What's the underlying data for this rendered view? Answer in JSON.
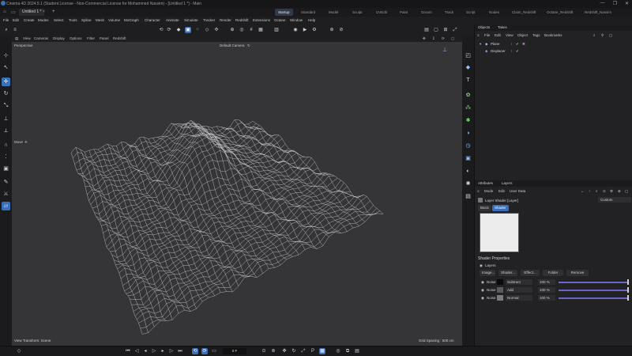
{
  "window": {
    "title": "Cinema 4D 2024.5.1 (Student License - Non-Commercial License for Mohammed Nassim) - [Untitled 1 *] - Main",
    "controls": [
      "—",
      "❐",
      "✕"
    ]
  },
  "document_tab": {
    "label": "Untitled 1 *",
    "close": "×",
    "add": "+"
  },
  "workspaces": [
    "Startup",
    "Standard",
    "Model",
    "Sculpt",
    "UVEdit",
    "Paint",
    "Groom",
    "Track",
    "Script",
    "Nodes",
    "Claim_Redshift",
    "Octane_Redshift",
    "Redshift_Nassim"
  ],
  "workspace_active": "Startup",
  "menus": [
    "File",
    "Edit",
    "Create",
    "Modes",
    "Select",
    "Tools",
    "Spline",
    "Mesh",
    "Volume",
    "MoGraph",
    "Character",
    "Animate",
    "Simulate",
    "Tracker",
    "Render",
    "Redshift",
    "Extensions",
    "Octane",
    "Window",
    "Help"
  ],
  "viewport": {
    "menu": [
      "View",
      "Cameras",
      "Display",
      "Options",
      "Filter",
      "Panel",
      "Redshift"
    ],
    "name": "Perspective",
    "camera": "Default Camera",
    "camera_glyph": "↻",
    "tool_label": "Move",
    "tool_glyph": "✛",
    "status_left": "View Transform: Scene",
    "status_right": "Grid Spacing : 500 cm"
  },
  "objects_panel": {
    "tabs": [
      "Objects",
      "Takes"
    ],
    "menu": [
      "File",
      "Edit",
      "View",
      "Object",
      "Tags",
      "Bookmarks"
    ],
    "objects": [
      {
        "name": "Plane",
        "check": "✔"
      },
      {
        "name": "Displacer",
        "check": "✔"
      }
    ]
  },
  "attributes_panel": {
    "tabs": [
      "Attributes",
      "Layers"
    ],
    "menu": [
      "Mode",
      "Edit",
      "User Data"
    ],
    "object_label": "Layer Shader [Layer]",
    "mode_dropdown": "Custom",
    "subtabs": [
      "Basic",
      "Shader"
    ],
    "subtab_active": "Shader",
    "section_title": "Shader Properties",
    "layers_label": "Layers",
    "buttons": [
      "Image...",
      "Shader...",
      "Effect...",
      "Folder",
      "Remove"
    ],
    "layers": [
      {
        "name": "Noise",
        "mode": "Subtract",
        "opacity": "100 %",
        "swatch": "#0a0a0a",
        "value": 1.0
      },
      {
        "name": "Noise",
        "mode": "Add",
        "opacity": "100 %",
        "swatch": "#5a5a5a",
        "value": 1.0
      },
      {
        "name": "Noise",
        "mode": "Normal",
        "opacity": "100 %",
        "swatch": "#7a7a7a",
        "value": 1.0
      }
    ]
  },
  "timeline": {
    "frame": "0 F"
  },
  "colors": {
    "accent": "#3b6fb8",
    "viewport_bg": "#353538",
    "panel_bg": "#222225",
    "slider": "#6a66c8"
  }
}
